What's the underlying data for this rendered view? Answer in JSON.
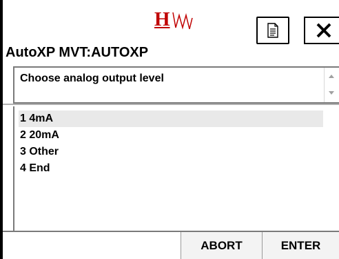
{
  "titlebar": {
    "logo_letter": "H",
    "logo_icon": "hart-wave-logo",
    "doc_icon": "document-icon",
    "close_icon": "close-icon"
  },
  "device": {
    "title": "AutoXP MVT:AUTOXP"
  },
  "prompt": {
    "text": "Choose analog output level"
  },
  "menu": {
    "selected_index": 0,
    "items": [
      {
        "label": "1 4mA"
      },
      {
        "label": "2 20mA"
      },
      {
        "label": "3 Other"
      },
      {
        "label": "4 End"
      }
    ]
  },
  "buttons": {
    "abort_label": "ABORT",
    "enter_label": "ENTER"
  },
  "colors": {
    "logo_red": "#c00000",
    "selection_bg": "#e9e9e9",
    "button_bg": "#f3f3f3",
    "border_gray": "#7a7a7a"
  }
}
